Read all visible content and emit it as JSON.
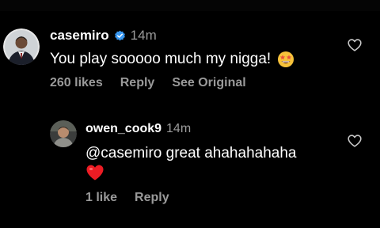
{
  "colors": {
    "background": "#000000",
    "text": "#ffffff",
    "muted": "#9a9a9a",
    "verified": "#3897f0",
    "heart": "#ed1c24"
  },
  "comments": [
    {
      "username": "casemiro",
      "verified": true,
      "time": "14m",
      "text": "You play sooooo much my nigga!",
      "emoji": "star-struck-emoji",
      "likes": "260 likes",
      "reply_label": "Reply",
      "see_original_label": "See Original"
    },
    {
      "username": "owen_cook9",
      "verified": false,
      "time": "14m",
      "text": "@casemiro great ahahahahaha",
      "emoji": "red-heart-emoji",
      "likes": "1 like",
      "reply_label": "Reply"
    }
  ],
  "icons": {
    "like": "heart-outline-icon",
    "verified": "verified-badge-icon"
  }
}
